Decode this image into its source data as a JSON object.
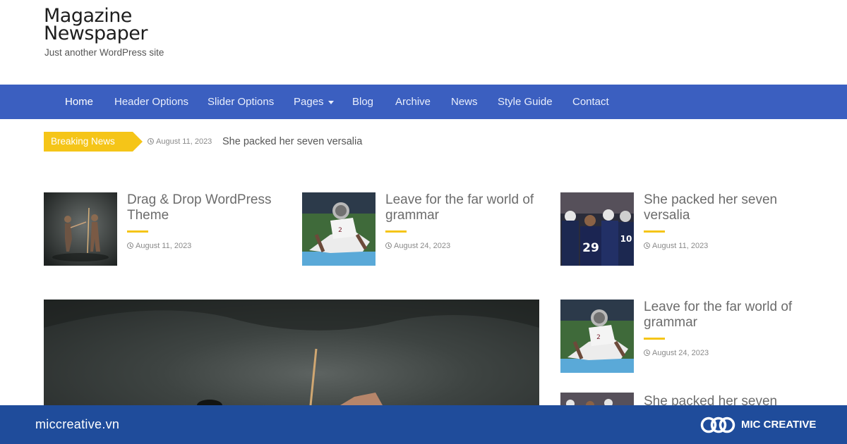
{
  "site": {
    "title_line1": "Magazine",
    "title_line2": "Newspaper",
    "tagline": "Just another WordPress site"
  },
  "nav": {
    "home": "Home",
    "header_options": "Header Options",
    "slider_options": "Slider Options",
    "pages": "Pages",
    "blog": "Blog",
    "archive": "Archive",
    "news": "News",
    "style_guide": "Style Guide",
    "contact": "Contact",
    "active": "Home"
  },
  "breaking": {
    "label": "Breaking News",
    "date": "August 11, 2023",
    "title": "She packed her seven versalia"
  },
  "posts": [
    {
      "title": "Drag & Drop WordPress Theme",
      "date": "August 11, 2023",
      "image": "fencing-duel"
    },
    {
      "title": "Leave for the far world of grammar",
      "date": "August 24, 2023",
      "image": "football-player-diving"
    },
    {
      "title": "She packed her seven versalia",
      "date": "August 11, 2023",
      "image": "football-team"
    }
  ],
  "sidebar": [
    {
      "title": "Leave for the far world of grammar",
      "date": "August 24, 2023",
      "image": "football-player-diving"
    },
    {
      "title": "She packed her seven",
      "image": "football-team"
    }
  ],
  "footer": {
    "site": "miccreative.vn",
    "brand": "MIC CREATIVE",
    "logo_icon": "mic-creative-logo-icon"
  },
  "colors": {
    "nav_bg": "#3b5fc0",
    "accent": "#f5c518",
    "footer_bg": "#1f4c9b"
  }
}
